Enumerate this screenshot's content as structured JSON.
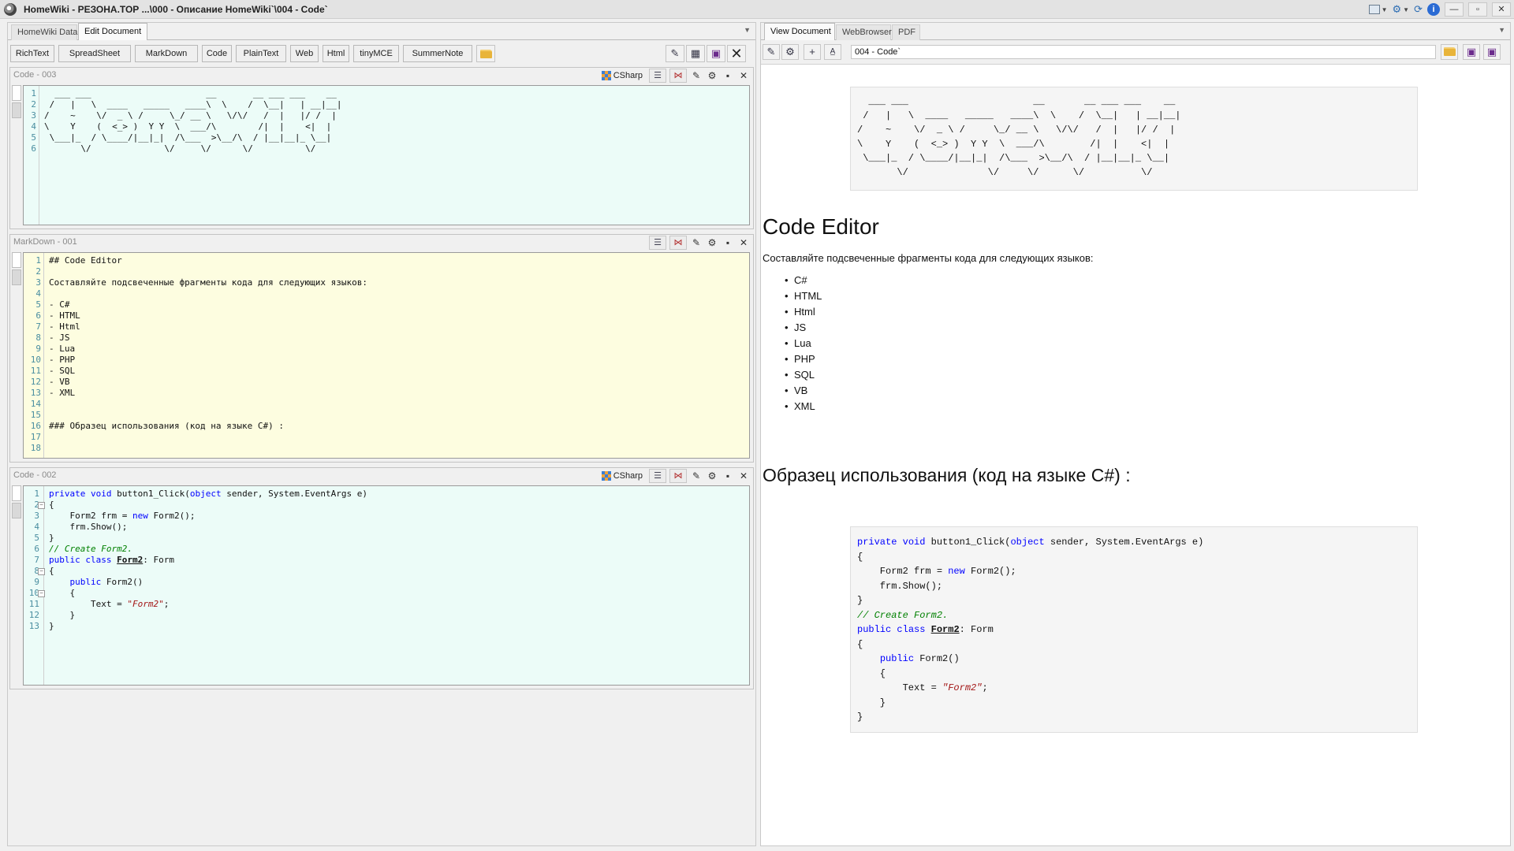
{
  "window": {
    "title": "HomeWiki - РЕЗОНА.ТОР  ...\\000 - Описание HomeWiki`\\004 - Code`"
  },
  "left": {
    "tabs": [
      "HomeWiki Data",
      "Edit Document"
    ],
    "toolbar": [
      "RichText",
      "SpreadSheet",
      "MarkDown",
      "Code",
      "PlainText",
      "Web",
      "Html",
      "tinyMCE",
      "SummerNote"
    ],
    "blocks": {
      "code003": {
        "title": "Code - 003",
        "lang": "CSharp",
        "line_numbers": "1\n2\n3\n4\n5\n6",
        "text": "  ___ ___                      __       __ ___ ___    __\n /   |   \\  ____   _____   ____\\  \\    /  \\__|   | __|__|\n/    ~    \\/  _ \\ /     \\_/ __ \\   \\/\\/   /  |   |/ /  |\n\\    Y    (  <_> )  Y Y  \\  ___/\\        /|  |    <|  |\n \\___|_  / \\____/|__|_|  /\\___  >\\__/\\  / |__|__|_ \\__|\n       \\/              \\/     \\/      \\/          \\/"
      },
      "markdown001": {
        "title": "MarkDown - 001",
        "line_numbers": "1\n2\n3\n4\n5\n6\n7\n8\n9\n10\n11\n12\n13\n14\n15\n16\n17\n18",
        "text": "## Code Editor\n\nСоставляйте подсвеченные фрагменты кода для следующих языков:\n\n- C#\n- HTML\n- Html\n- JS\n- Lua\n- PHP\n- SQL\n- VB\n- XML\n\n\n### Образец использования (код на языке C#) :\n\n"
      },
      "code002": {
        "title": "Code - 002",
        "lang": "CSharp",
        "line_numbers": "1\n2\n3\n4\n5\n6\n7\n8\n9\n10\n11\n12\n13",
        "code": [
          [
            "kw:private",
            "t: ",
            "kw:void",
            "t: button1_Click(",
            "kw:object",
            "t: sender, System.EventArgs e)"
          ],
          [
            "t:{"
          ],
          [
            "t:    Form2 frm = ",
            "kw:new",
            "t: Form2();"
          ],
          [
            "t:    frm.Show();"
          ],
          [
            "t:}"
          ],
          [
            "cm:// Create Form2."
          ],
          [
            "kw:public",
            "t: ",
            "kw:class",
            "t: ",
            "cls:Form2",
            "t:: Form"
          ],
          [
            "t:{"
          ],
          [
            "t:    ",
            "kw:public",
            "t: Form2()"
          ],
          [
            "t:    {"
          ],
          [
            "t:        Text = ",
            "str:\"Form2\"",
            "t:;"
          ],
          [
            "t:    }"
          ],
          [
            "t:}"
          ]
        ]
      }
    }
  },
  "right": {
    "tabs": [
      "View Document",
      "WebBrowser",
      "PDF"
    ],
    "address": "004 - Code`",
    "doc": {
      "h2": "Code Editor",
      "intro": "Составляйте подсвеченные фрагменты кода для следующих языков:",
      "languages": [
        "C#",
        "HTML",
        "Html",
        "JS",
        "Lua",
        "PHP",
        "SQL",
        "VB",
        "XML"
      ],
      "h3": "Образец использования (код на языке C#) :"
    }
  },
  "colors": {
    "code_bg": "#ecfcf8",
    "markdown_bg": "#fdfde0",
    "keyword": "#0000ff",
    "comment": "#008000",
    "string": "#a31515"
  }
}
